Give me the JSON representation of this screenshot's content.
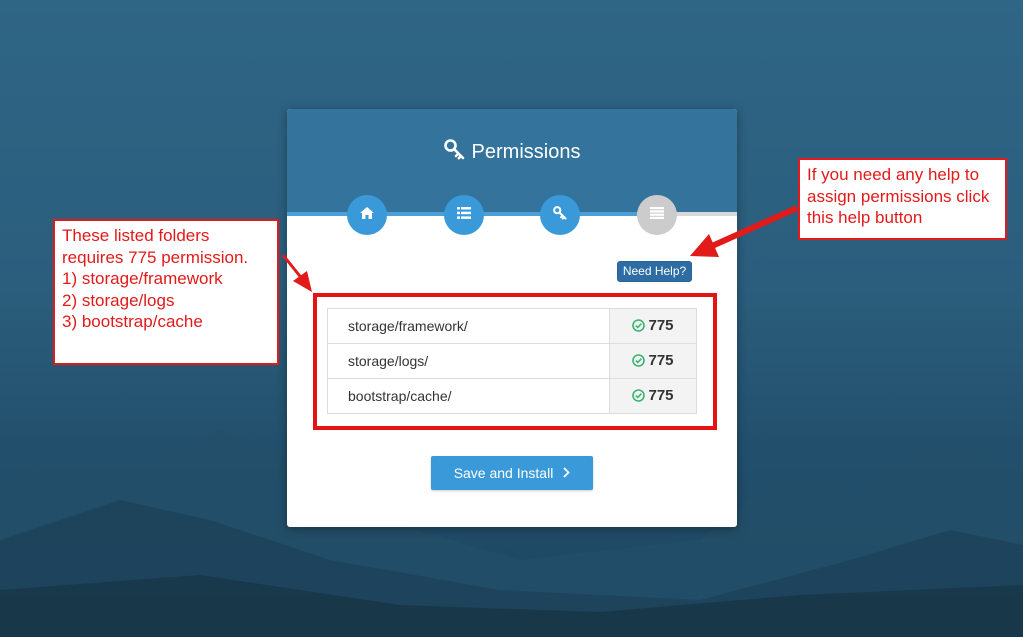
{
  "header": {
    "title": "Permissions",
    "title_icon": "key-icon"
  },
  "steps": [
    {
      "icon": "home-icon",
      "state": "done"
    },
    {
      "icon": "list-icon",
      "state": "done"
    },
    {
      "icon": "key-icon",
      "state": "active"
    },
    {
      "icon": "list-icon",
      "state": "pending"
    }
  ],
  "help_button": {
    "label": "Need Help?"
  },
  "permissions": [
    {
      "folder": "storage/framework/",
      "value": "775",
      "status": "ok"
    },
    {
      "folder": "storage/logs/",
      "value": "775",
      "status": "ok"
    },
    {
      "folder": "bootstrap/cache/",
      "value": "775",
      "status": "ok"
    }
  ],
  "save_button": {
    "label": "Save and Install",
    "icon": "chevron-right-icon"
  },
  "annotations": {
    "left": "These listed folders\nrequires 775 permission.\n1) storage/framework\n2) storage/logs\n3) bootstrap/cache",
    "right": "If you need any help to\nassign permissions click\nthis help button"
  },
  "colors": {
    "header": "#33739c",
    "accent": "#3a9ad9",
    "annotation_red": "#e21a1a",
    "check_green": "#3cb371"
  }
}
